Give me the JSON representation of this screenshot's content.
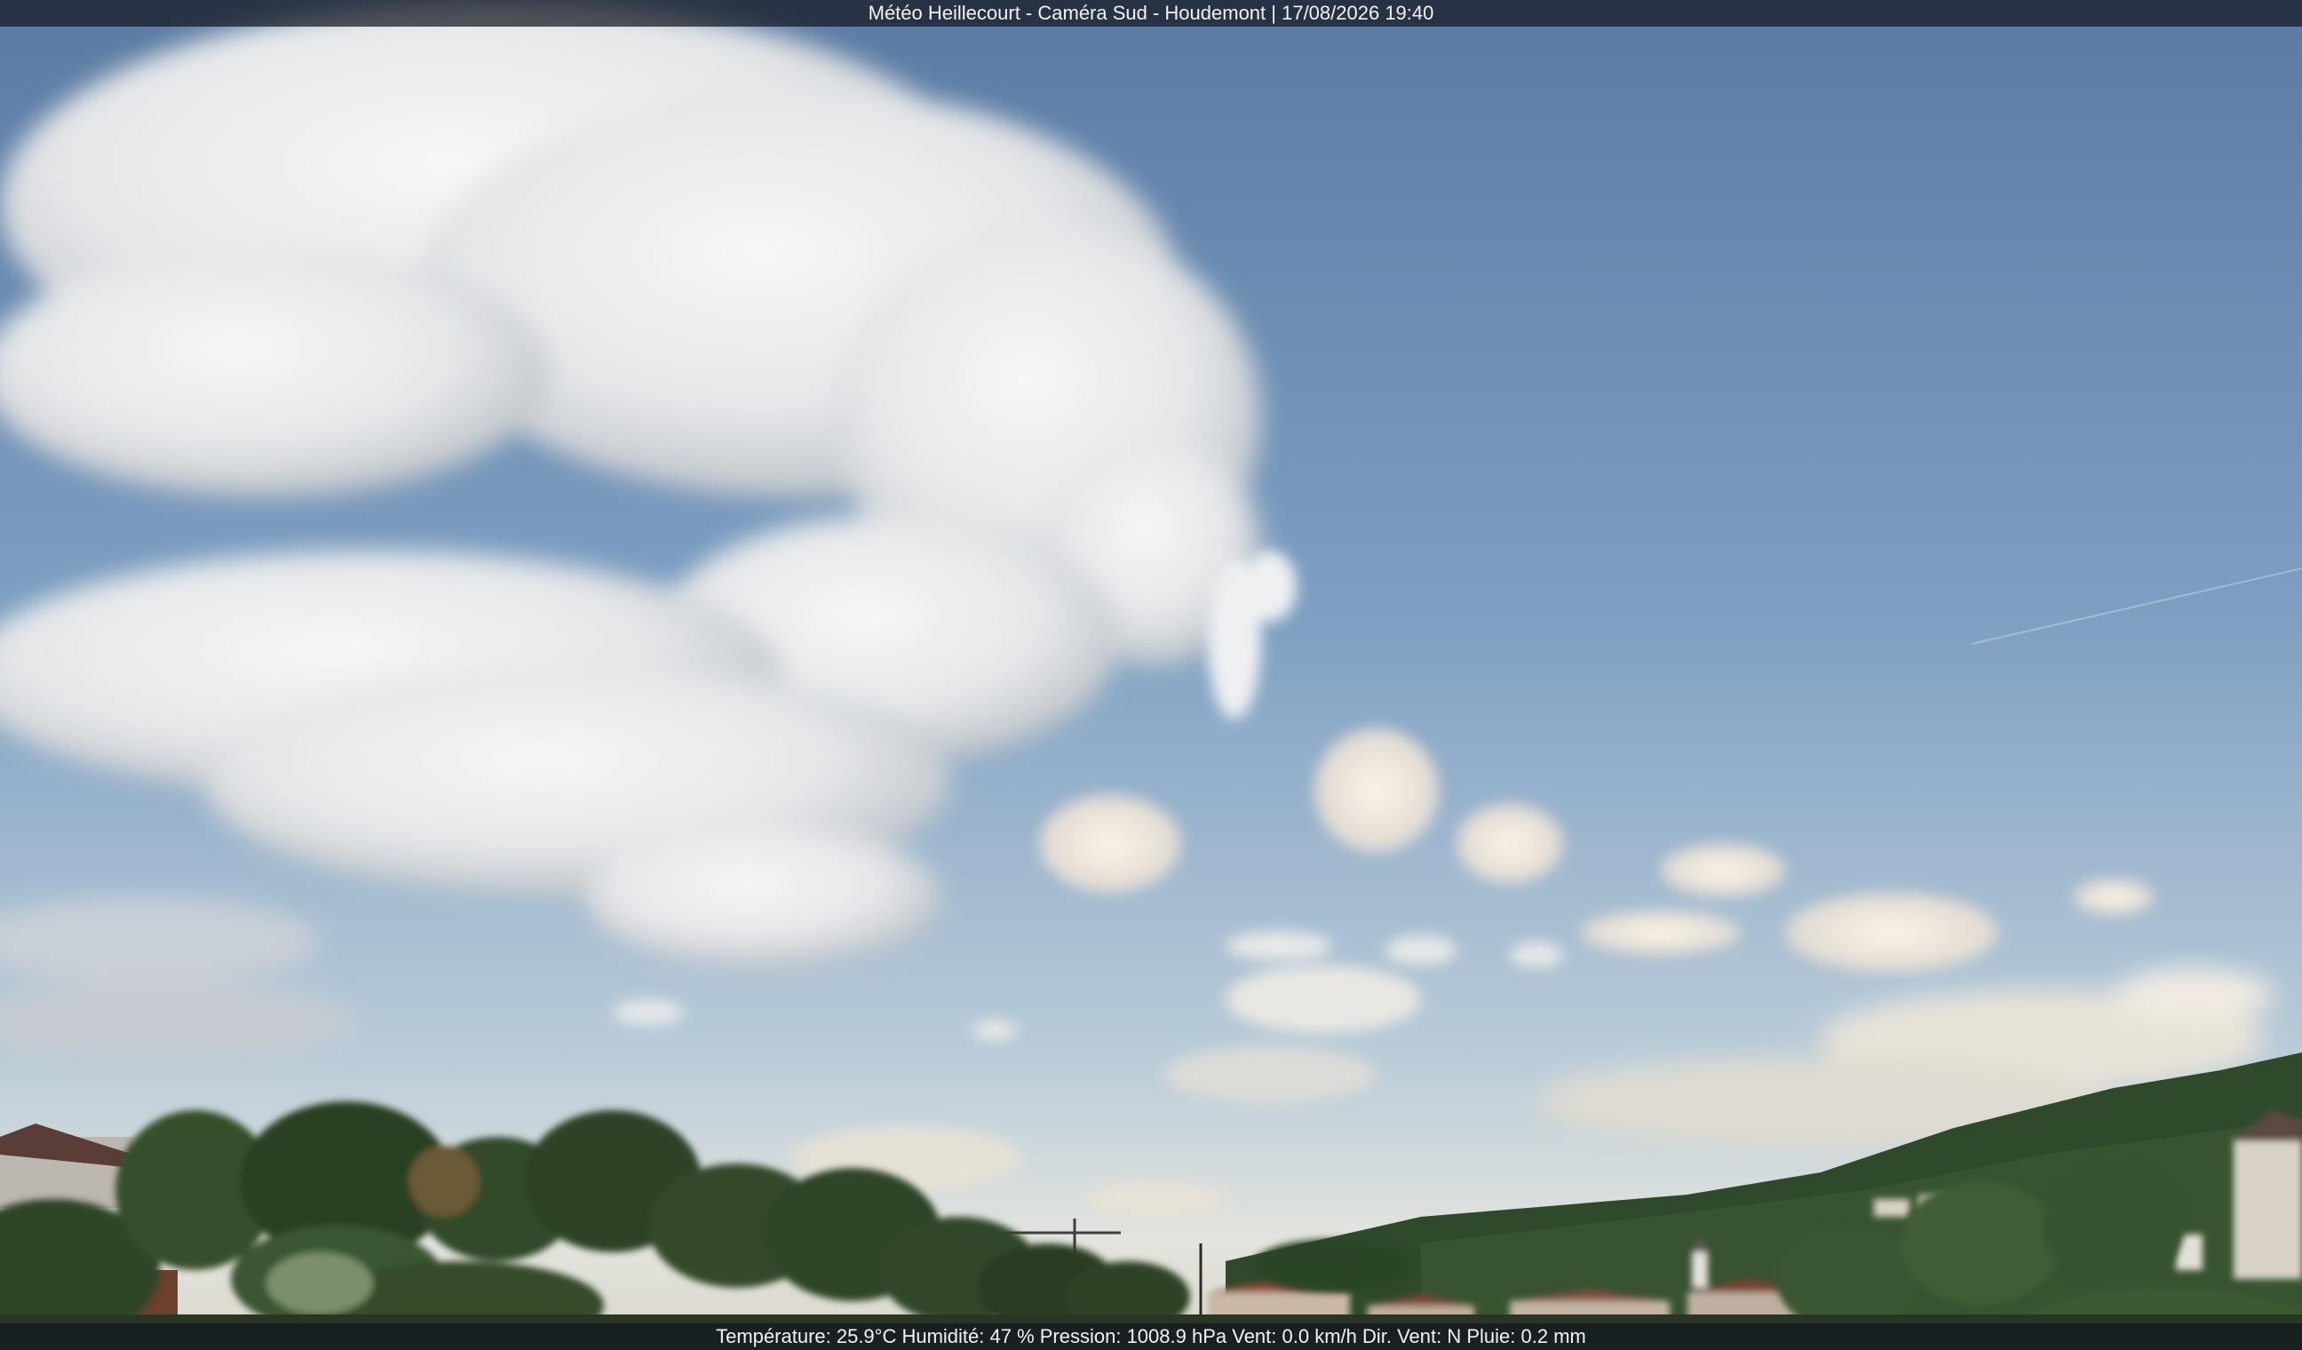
{
  "overlay": {
    "title": "Météo Heillecourt - Caméra Sud - Houdemont | 17/08/2026 19:40",
    "readings": "Température: 25.9°C  Humidité: 47 % Pression: 1008.9 hPa Vent: 0.0 km/h Dir. Vent: N Pluie: 0.2 mm"
  },
  "colors": {
    "sky_top": "#5f7ea6",
    "sky_mid": "#87a8c9",
    "sky_horizon": "#dfe3e0",
    "cloud": "#f1f2f3",
    "cloud_shadow": "#b8bdc2",
    "hill": "#2f4a2c",
    "trees": "#2d4226",
    "roof": "#8a4a3a",
    "overlay_bar": "#14181f"
  }
}
